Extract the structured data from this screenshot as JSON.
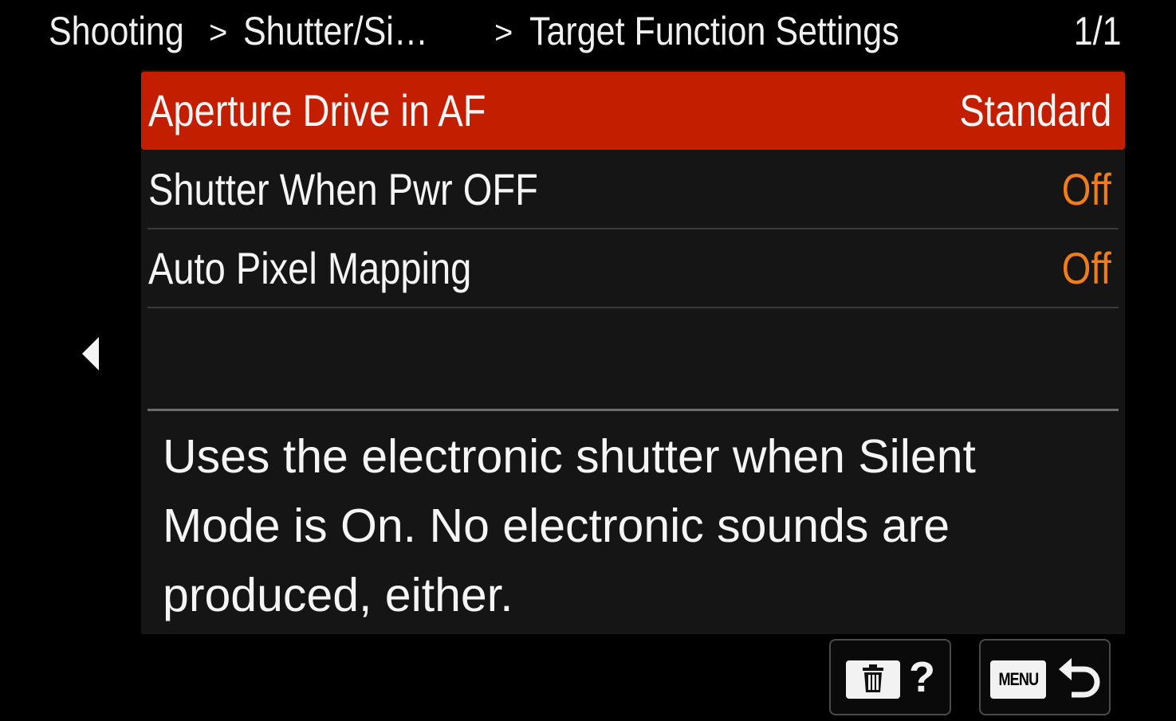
{
  "header": {
    "breadcrumb": [
      {
        "label": "Shooting"
      },
      {
        "label": "Shutter/Si…"
      },
      {
        "label": "Target Function Settings"
      }
    ],
    "separator": ">",
    "page_indicator": "1/1"
  },
  "menu": {
    "items": [
      {
        "label": "Aperture Drive in AF",
        "value": "Standard",
        "selected": true
      },
      {
        "label": "Shutter When Pwr OFF",
        "value": "Off",
        "selected": false
      },
      {
        "label": "Auto Pixel Mapping",
        "value": "Off",
        "selected": false
      }
    ]
  },
  "description": "Uses the electronic shutter when Silent\nMode is On. No electronic sounds are\nproduced, either.",
  "footer": {
    "delete_help": {
      "icon": "trash-icon",
      "glyph": "?"
    },
    "menu_return": {
      "menu_label": "MENU",
      "icon": "return-arrow-icon"
    }
  },
  "nav": {
    "back_icon": "left-arrow-icon"
  },
  "colors": {
    "background": "#000000",
    "panel": "#151515",
    "selected_row": "#c41e00",
    "value_accent": "#f07d1a",
    "text": "#f5f5f5"
  }
}
